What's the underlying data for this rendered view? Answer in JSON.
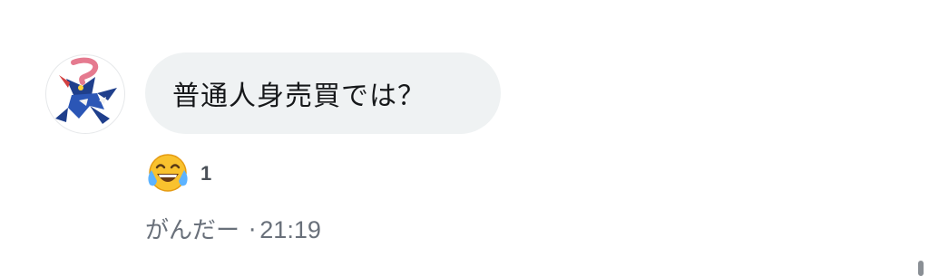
{
  "comment": {
    "message": "普通人身売買では？",
    "reaction": {
      "emoji": "face-with-tears-of-joy-icon",
      "count": "1"
    },
    "author": "がんだー",
    "separator": "·",
    "time": "21:19"
  },
  "colors": {
    "bubble": "#eff2f3",
    "text": "#16181a",
    "meta": "#69707a"
  }
}
